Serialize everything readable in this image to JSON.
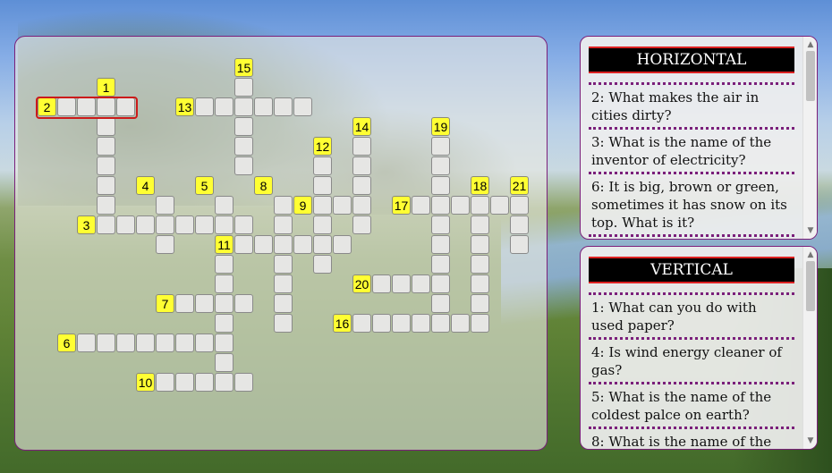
{
  "crossword": {
    "numbers": [
      "1",
      "2",
      "3",
      "4",
      "5",
      "6",
      "7",
      "8",
      "9",
      "10",
      "11",
      "12",
      "13",
      "14",
      "15",
      "16",
      "17",
      "18",
      "19",
      "20",
      "21"
    ]
  },
  "horizontal": {
    "title": "HORIZONTAL",
    "clues": [
      "2: What makes the air in cities dirty?",
      "3: What is the name of the inventor of electricity?",
      "6: It is big, brown or green, sometimes it has snow on its top. What is it?"
    ]
  },
  "vertical": {
    "title": "VERTICAL",
    "clues": [
      "1: What can you do with used paper?",
      "4: Is wind energy cleaner of gas?",
      "5: What is the name of the coldest palce on earth?",
      "8: What is the name of the"
    ]
  },
  "scroll_arrows": {
    "up": "▲",
    "down": "▼"
  }
}
